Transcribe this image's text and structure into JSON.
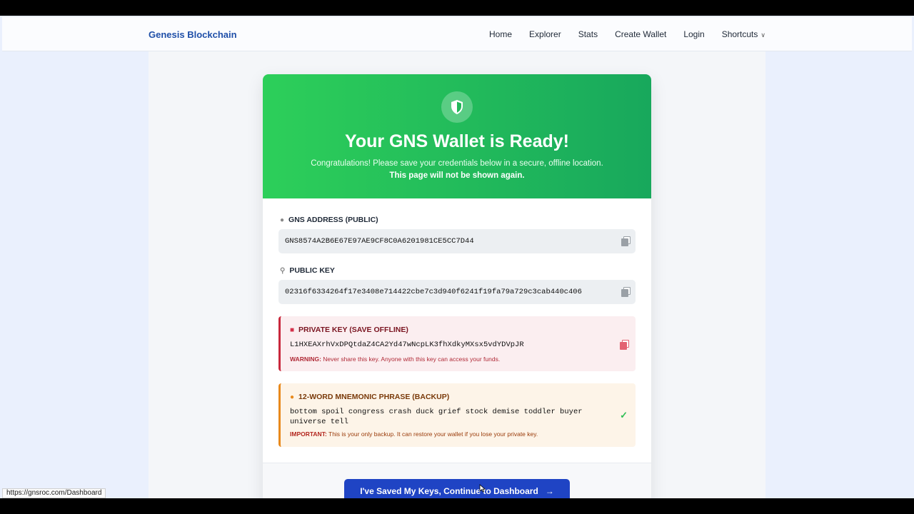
{
  "navbar": {
    "brand": "Genesis Blockchain",
    "links": [
      "Home",
      "Explorer",
      "Stats",
      "Create Wallet",
      "Login",
      "Shortcuts"
    ]
  },
  "hero": {
    "icon": "shield-icon",
    "title": "Your GNS Wallet is Ready!",
    "subtitle": "Congratulations! Please save your credentials below in a secure, offline location.",
    "subtitle_bold": "This page will not be shown again."
  },
  "address": {
    "label": "GNS ADDRESS (PUBLIC)",
    "icon": "location-pin-icon",
    "value": "GNS8574A2B6E67E97AE9CF8C0A6201981CE5CC7D44"
  },
  "public_key": {
    "label": "PUBLIC KEY",
    "icon": "key-icon",
    "value": "02316f6334264f17e3408e714422cbe7c3d940f6241f19fa79a729c3cab440c406"
  },
  "private_key": {
    "label": "PRIVATE KEY (SAVE OFFLINE)",
    "icon": "bank-icon",
    "value": "L1HXEAXrhVxDPQtdaZ4CA2Yd47wNcpLK3fhXdkyMXsx5vdYDVpJR",
    "warning_label": "WARNING:",
    "warning_text": "Never share this key. Anyone with this key can access your funds."
  },
  "mnemonic": {
    "label": "12-WORD MNEMONIC PHRASE (BACKUP)",
    "icon": "brain-icon",
    "value": "bottom spoil congress crash duck grief stock demise toddler buyer universe tell",
    "important_label": "IMPORTANT:",
    "important_text": "This is your only backup. It can restore your wallet if you lose your private key."
  },
  "cta": {
    "label": "I've Saved My Keys, Continue to Dashboard"
  },
  "status_bar": {
    "url": "https://gnsroc.com/Dashboard"
  },
  "colors": {
    "hero_start": "#2dcf5a",
    "hero_end": "#18a85c",
    "cta": "#1f44c4",
    "danger": "#c8283c",
    "warning": "#e8891c",
    "brand": "#1f4fa8"
  }
}
